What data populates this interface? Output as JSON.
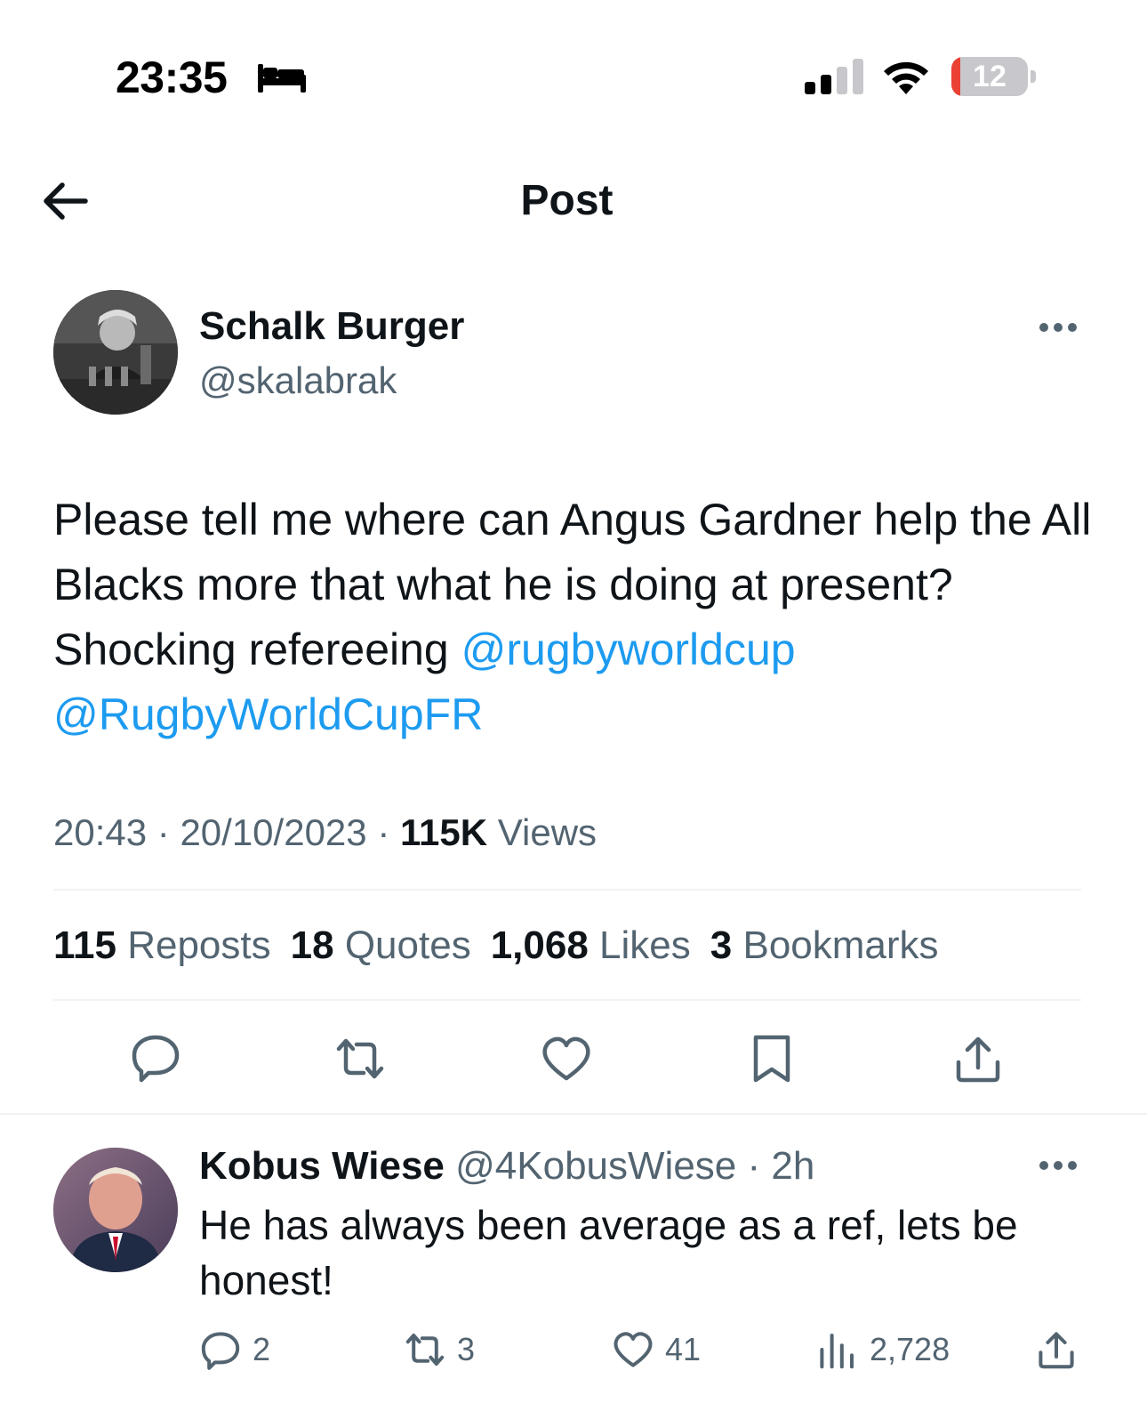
{
  "status_bar": {
    "time": "23:35",
    "battery_level": "12",
    "battery_color": "#eb4034"
  },
  "header": {
    "title": "Post"
  },
  "post": {
    "author_name": "Schalk Burger",
    "author_handle": "@skalabrak",
    "text_parts": [
      "Please tell me where can Angus Gardner help the All Blacks more that what he is doing at present? Shocking refereeing ",
      "@rugbyworldcup",
      " ",
      "@RugbyWorldCupFR"
    ],
    "time": "20:43",
    "date": "20/10/2023",
    "views_count": "115K",
    "views_label": "Views",
    "stats": [
      {
        "count": "115",
        "label": "Reposts"
      },
      {
        "count": "18",
        "label": "Quotes"
      },
      {
        "count": "1,068",
        "label": "Likes"
      },
      {
        "count": "3",
        "label": "Bookmarks"
      }
    ]
  },
  "reply": {
    "name": "Kobus Wiese",
    "handle": "@4KobusWiese",
    "time": "2h",
    "text": "He has always been average as a ref, lets be honest!",
    "replies": "2",
    "reposts": "3",
    "likes": "41",
    "views": "2,728"
  },
  "colors": {
    "link": "#1d9bf0",
    "secondary_text": "#536471",
    "icon": "#536471"
  }
}
